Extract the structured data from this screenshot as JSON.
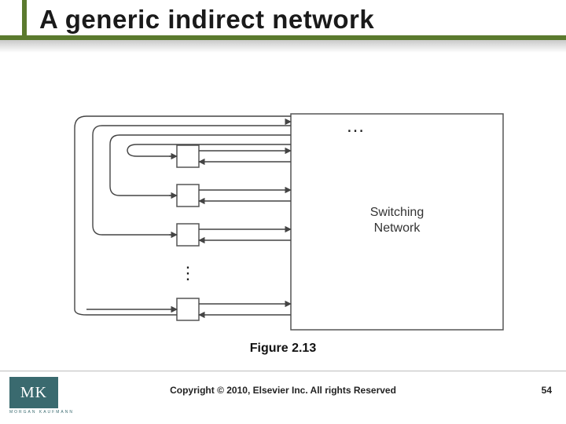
{
  "slide": {
    "title": "A generic indirect network",
    "caption": "Figure 2.13",
    "copyright": "Copyright © 2010, Elsevier Inc. All rights Reserved",
    "page_number": "54"
  },
  "logo": {
    "initials": "MK",
    "publisher": "MORGAN KAUFMANN"
  },
  "diagram": {
    "switching_box_label_l1": "Switching",
    "switching_box_label_l2": "Network",
    "ellipsis_top": "…",
    "ellipsis_left": "⋮"
  },
  "colors": {
    "accent": "#5b7a2e",
    "logo_bg": "#3a6a6f"
  }
}
